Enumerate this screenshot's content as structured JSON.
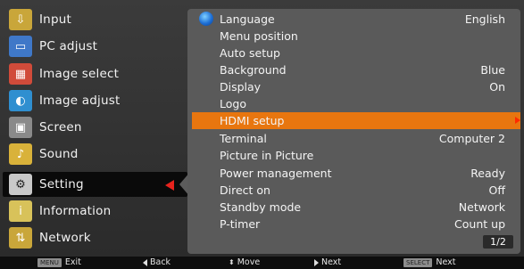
{
  "left_menu": [
    {
      "label": "Input",
      "icon": "input-icon",
      "color": "#c9a63a"
    },
    {
      "label": "PC adjust",
      "icon": "pc-adjust-icon",
      "color": "#3f78c8"
    },
    {
      "label": "Image select",
      "icon": "image-select-icon",
      "color": "#d14b3a"
    },
    {
      "label": "Image adjust",
      "icon": "image-adjust-icon",
      "color": "#2f8fd0"
    },
    {
      "label": "Screen",
      "icon": "screen-icon",
      "color": "#8a8a8a"
    },
    {
      "label": "Sound",
      "icon": "sound-icon",
      "color": "#d9b23a"
    },
    {
      "label": "Setting",
      "icon": "setting-icon",
      "color": "#c9c9c9",
      "selected": true
    },
    {
      "label": "Information",
      "icon": "information-icon",
      "color": "#d8c25a"
    },
    {
      "label": "Network",
      "icon": "network-icon",
      "color": "#c9a63a"
    }
  ],
  "settings": [
    {
      "label": "Language",
      "value": "English"
    },
    {
      "label": "Menu position",
      "value": ""
    },
    {
      "label": "Auto setup",
      "value": ""
    },
    {
      "label": "Background",
      "value": "Blue"
    },
    {
      "label": "Display",
      "value": "On"
    },
    {
      "label": "Logo",
      "value": ""
    },
    {
      "label": "HDMI setup",
      "value": "",
      "highlighted": true
    },
    {
      "label": "Terminal",
      "value": "Computer 2"
    },
    {
      "label": "Picture in Picture",
      "value": ""
    },
    {
      "label": "Power management",
      "value": "Ready"
    },
    {
      "label": "Direct on",
      "value": "Off"
    },
    {
      "label": "Standby mode",
      "value": "Network"
    },
    {
      "label": "P-timer",
      "value": "Count up"
    }
  ],
  "page_indicator": "1/2",
  "footer": {
    "exit_key": "MENU",
    "exit": "Exit",
    "back": "Back",
    "move": "Move",
    "next": "Next",
    "select_key": "SELECT",
    "select_next": "Next"
  },
  "colors": {
    "highlight": "#e8760f",
    "selection_arrow": "#e8231d",
    "panel": "#5a5a5a"
  }
}
